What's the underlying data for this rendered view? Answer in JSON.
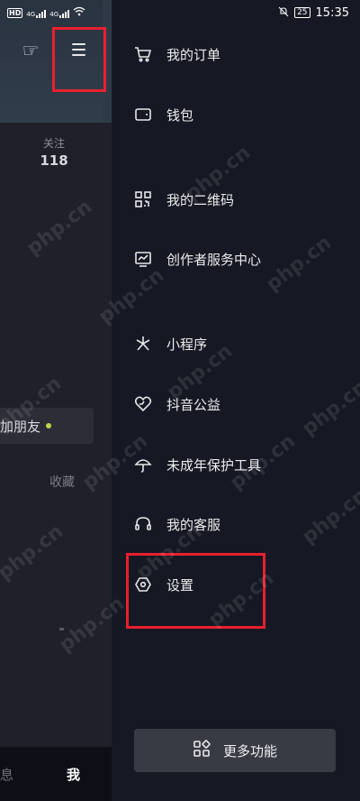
{
  "status_bar": {
    "left_badge": "HD",
    "sim1": "4G",
    "sim2": "4G",
    "battery": "25",
    "time": "15:35",
    "icons": [
      "hd-icon",
      "signal-icon",
      "wifi-icon",
      "mute-icon",
      "battery-icon"
    ]
  },
  "left_pane": {
    "follow_label": "关注",
    "follow_count": "118",
    "add_friend": "加朋友",
    "collect": "收藏",
    "tab_messages": "息",
    "tab_me": "我",
    "icons": [
      "hand-point-icon",
      "menu-icon"
    ]
  },
  "drawer": {
    "items": [
      {
        "label": "我的订单",
        "icon": "cart-icon"
      },
      {
        "label": "钱包",
        "icon": "wallet-icon"
      },
      {
        "label": "我的二维码",
        "icon": "qrcode-icon"
      },
      {
        "label": "创作者服务中心",
        "icon": "chart-board-icon"
      },
      {
        "label": "小程序",
        "icon": "mini-program-icon"
      },
      {
        "label": "抖音公益",
        "icon": "charity-heart-icon"
      },
      {
        "label": "未成年保护工具",
        "icon": "umbrella-icon"
      },
      {
        "label": "我的客服",
        "icon": "headset-icon"
      },
      {
        "label": "设置",
        "icon": "settings-hex-icon"
      }
    ],
    "more_button": "更多功能",
    "more_icon": "grid-apps-icon"
  },
  "watermark": "php.cn",
  "colors": {
    "background": "#161823",
    "highlight_box": "#e8202f",
    "online_dot": "#b8d64a",
    "button_bg": "#393b44"
  }
}
